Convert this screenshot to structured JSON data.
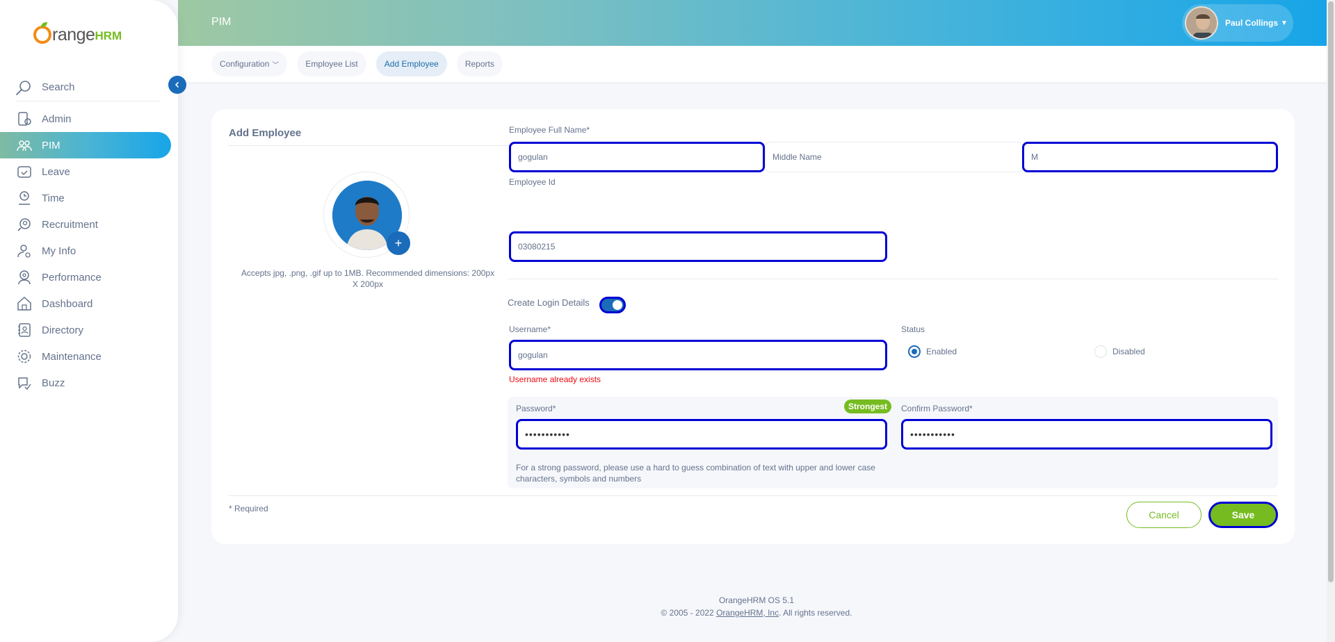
{
  "brand": {
    "orange": "range",
    "hrm": "HRM"
  },
  "sidebar": {
    "search_placeholder": "Search",
    "items": [
      {
        "label": "Admin",
        "icon": "admin-icon"
      },
      {
        "label": "PIM",
        "icon": "pim-icon",
        "active": true
      },
      {
        "label": "Leave",
        "icon": "leave-icon"
      },
      {
        "label": "Time",
        "icon": "time-icon"
      },
      {
        "label": "Recruitment",
        "icon": "recruitment-icon"
      },
      {
        "label": "My Info",
        "icon": "my-info-icon"
      },
      {
        "label": "Performance",
        "icon": "performance-icon"
      },
      {
        "label": "Dashboard",
        "icon": "dashboard-icon"
      },
      {
        "label": "Directory",
        "icon": "directory-icon"
      },
      {
        "label": "Maintenance",
        "icon": "maintenance-icon"
      },
      {
        "label": "Buzz",
        "icon": "buzz-icon"
      }
    ]
  },
  "header": {
    "module": "PIM",
    "user_name": "Paul Collings",
    "tabs": [
      {
        "label": "Configuration",
        "dropdown": true
      },
      {
        "label": "Employee List"
      },
      {
        "label": "Add Employee",
        "active": true
      },
      {
        "label": "Reports"
      }
    ]
  },
  "form": {
    "title": "Add Employee",
    "photo_hint": "Accepts jpg, .png, .gif up to 1MB. Recommended dimensions: 200px X 200px",
    "full_name_label": "Employee Full Name*",
    "first_name_value": "gogulan",
    "middle_name_placeholder": "Middle Name",
    "last_name_value": "M",
    "employee_id_label": "Employee Id",
    "employee_id_value": "03080215",
    "login_toggle_label": "Create Login Details",
    "login_enabled": true,
    "username_label": "Username*",
    "username_value": "gogulan",
    "username_error": "Username already exists",
    "status_label": "Status",
    "status_enabled": "Enabled",
    "status_disabled": "Disabled",
    "status_selected": "Enabled",
    "password_label": "Password*",
    "password_strength": "Strongest",
    "password_value": "•••••••••••",
    "confirm_password_label": "Confirm Password*",
    "confirm_password_value": "•••••••••••",
    "password_hint": "For a strong password, please use a hard to guess combination of text with upper and lower case characters, symbols and numbers",
    "required_note": "* Required",
    "cancel_label": "Cancel",
    "save_label": "Save"
  },
  "footer": {
    "version": "OrangeHRM OS 5.1",
    "copyright_prefix": "© 2005 - 2022 ",
    "company_link": "OrangeHRM, Inc",
    "copyright_suffix": ". All rights reserved."
  },
  "colors": {
    "accent_green": "#76bc21",
    "accent_blue": "#1a6bba",
    "focus_outline": "#0000d4",
    "error_red": "#eb0910",
    "brand_orange": "#f28c18"
  }
}
